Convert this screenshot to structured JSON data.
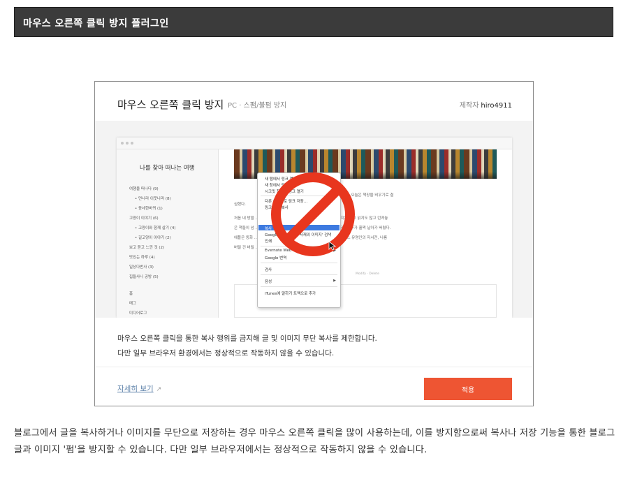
{
  "page": {
    "heading": "마우스 오른쪽 클릭 방지 플러그인"
  },
  "card": {
    "title": "마우스 오른쪽 클릭 방지",
    "subtitle": "PC · 스팸/불펌 방지",
    "author_label": "제작자",
    "author_name": "hiro4911",
    "description_line1": "마우스 오른쪽 클릭을 통한 복사 행위를 금지해 글 및 이미지 무단 복사를 제한합니다.",
    "description_line2": "다만 일부 브라우저 환경에서는 정상적으로 작동하지 않을 수 있습니다.",
    "more_link": "자세히 보기",
    "apply_button": "적용"
  },
  "preview": {
    "blog_title": "나를 찾아 떠나는 여행",
    "sidebar_items": [
      "여행을 떠나다 (9)",
      "• 먼나라 이웃나라 (8)",
      "• 동네한바퀴 (1)",
      "고양이 이야기 (6)",
      "• 고양이와 함께 살기 (4)",
      "• 길고양이 이야기 (2)",
      "보고 듣고 느낀 것 (2)",
      "맛있는 하루 (4)",
      "일상다반사 (3)",
      "집들사니 공방 (5)",
      "홈",
      "태그",
      "미디어로그"
    ],
    "post_text": [
      "고자 청소하는 과정을 하나하나 남겨놓을까 한다. 오늘은 책장을 비우기로 결",
      "심했다.",
      "처음 내 방을 ... 인 오래된 서재의 이미지였을 텐데, 몇 년간 정리하지는 않고 읽지도 않고 던져놓",
      "은 책들이 넘 ... 는 기 ... 로 책을 한 권 두 권 꺼내 분류하다 보니 주말 오후가 훌쩍 날아가 버렸다.",
      "애플은 동화 ... 처럼 ... 가 수 숙제 때문에 한 번 읽고 펼쳐보지 않은 어느 유명인의 자서전, 나름",
      "버릴 건 버릴 ... 해 ... 이 점을 좋아하."
    ],
    "post_meta": "Modify · Delete",
    "context_menu": [
      "새 탭에서 링크 열기",
      "새 창에서 링크 열기",
      "시크릿 창에서 링크 열기",
      "다른 이름으로 링크 저장...",
      "링크 주소 복사",
      "복사",
      "Google에서 '오래된 서재의 이미지' 검색",
      "인쇄",
      "Evernote Web Clipper",
      "Google 번역",
      "검사",
      "음성",
      "iTunes에 말하기 트랙으로 추가"
    ],
    "ban_color": "#e8361e"
  },
  "body_text": "블로그에서 글을 복사하거나 이미지를 무단으로 저장하는 경우 마우스 오른쪽 클릭을 많이 사용하는데, 이를 방지함으로써 복사나 저장 기능을 통한 블로그 글과 이미지 '펌'을 방지할 수 있습니다. 다만 일부 브라우저에서는 정상적으로 작동하지 않을 수 있습니다."
}
